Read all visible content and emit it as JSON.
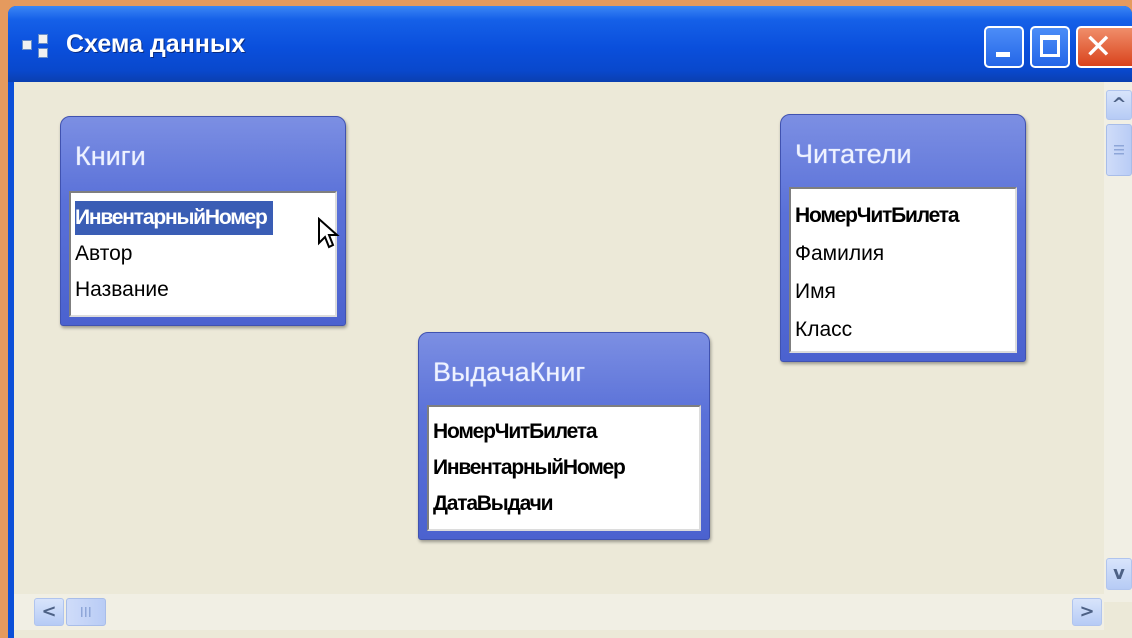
{
  "window": {
    "title": "Схема данных",
    "icon": "relationships-icon",
    "controls": [
      "minimize",
      "maximize",
      "close"
    ]
  },
  "tables": [
    {
      "name": "Книги",
      "fields": [
        {
          "label": "ИнвентарныйНомер",
          "key": true,
          "selected": true
        },
        {
          "label": "Автор",
          "key": false
        },
        {
          "label": "Название",
          "key": false
        }
      ]
    },
    {
      "name": "Читатели",
      "fields": [
        {
          "label": "НомерЧитБилета",
          "key": true
        },
        {
          "label": "Фамилия",
          "key": false
        },
        {
          "label": "Имя",
          "key": false
        },
        {
          "label": "Класс",
          "key": false
        }
      ]
    },
    {
      "name": "ВыдачаКниг",
      "fields": [
        {
          "label": "НомерЧитБилета",
          "key": true
        },
        {
          "label": "ИнвентарныйНомер",
          "key": true
        },
        {
          "label": "ДатаВыдачи",
          "key": true
        }
      ]
    }
  ],
  "scroll": {
    "up": "^",
    "down": "v",
    "left": "<",
    "right": ">"
  },
  "colors": {
    "titlebar": "#0a4fdc",
    "canvas": "#ece9d8",
    "table_header": "#5a71d8",
    "selection": "#3a5db5",
    "close_button": "#d9431d"
  }
}
